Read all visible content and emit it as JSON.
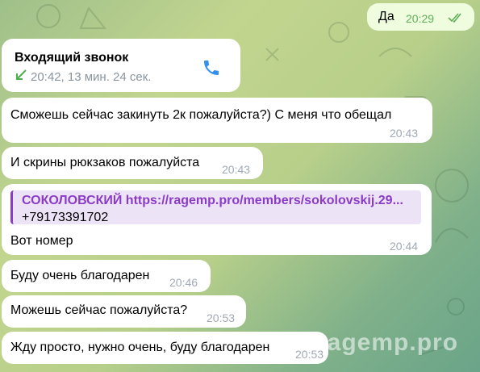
{
  "outgoing": {
    "text": "Да",
    "time": "20:29"
  },
  "call": {
    "title": "Входящий звонок",
    "details": "20:42, 13 мин. 24 сек.",
    "icon": "phone-icon",
    "arrow_icon": "incoming-arrow-icon"
  },
  "messages": [
    {
      "text": "Сможешь сейчас закинуть 2к пожалуйста?) С меня что обещал",
      "time": "20:43"
    },
    {
      "text": "И скрины рюкзаков пожалуйста",
      "time": "20:43"
    },
    {
      "quote_title": "СОКОЛОВСКИЙ https://ragemp.pro/members/sokolovskij.29...",
      "quote_text": "+79173391702",
      "text": "Вот номер",
      "time": "20:44"
    },
    {
      "text": "Буду очень благодарен",
      "time": "20:46"
    },
    {
      "text": "Можешь сейчас пожалуйста?",
      "time": "20:53"
    },
    {
      "text": "Жду просто, нужно очень, буду благодарен",
      "time": "20:53"
    }
  ],
  "watermark": "ragemp.pro",
  "colors": {
    "accent": "#8a3cc6",
    "check": "#5fae5a",
    "phone": "#3390ec",
    "bubble_out": "#effdde"
  }
}
